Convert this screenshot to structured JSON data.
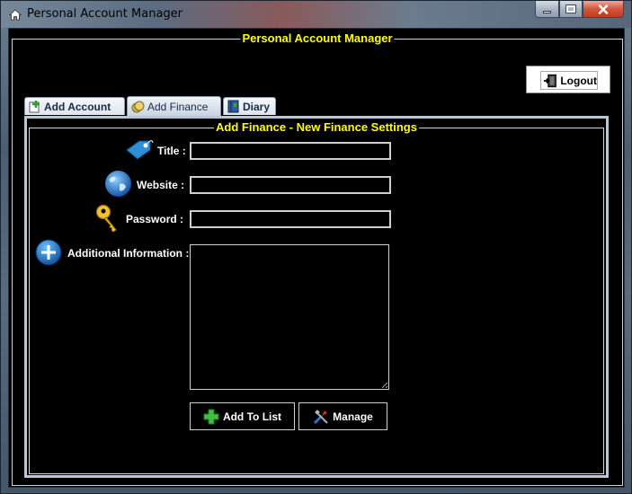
{
  "window": {
    "title": "Personal Account Manager",
    "icon": "home-icon"
  },
  "header": {
    "group_title": "Personal Account Manager",
    "logout_label": "Logout"
  },
  "tabs": [
    {
      "label": "Add Account",
      "icon": "add-page-icon",
      "active": false
    },
    {
      "label": "Add Finance",
      "icon": "coin-icon",
      "active": true
    },
    {
      "label": "Diary",
      "icon": "diary-icon",
      "active": false
    }
  ],
  "form": {
    "group_title": "Add Finance - New Finance Settings",
    "title_label": "Title :",
    "title_value": "",
    "website_label": "Website :",
    "website_value": "",
    "password_label": "Password :",
    "password_value": "",
    "additional_label": "Additional Information :",
    "additional_value": "",
    "add_to_list_label": "Add To List",
    "manage_label": "Manage"
  },
  "colors": {
    "accent_title": "#ffff00",
    "background": "#000000",
    "border": "#cfd6de"
  }
}
